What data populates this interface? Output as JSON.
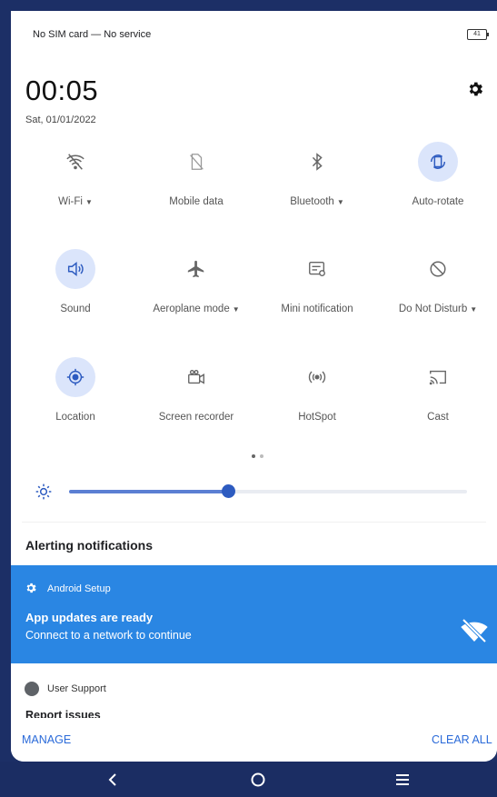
{
  "status": {
    "carrier_text": "No SIM card — No service",
    "battery_level": "41"
  },
  "clock": {
    "time": "00:05",
    "date": "Sat, 01/01/2022"
  },
  "tiles": [
    {
      "label": "Wi-Fi",
      "icon": "wifi-off-icon",
      "dropdown": true,
      "active": false
    },
    {
      "label": "Mobile data",
      "icon": "sim-off-icon",
      "dropdown": false,
      "active": false
    },
    {
      "label": "Bluetooth",
      "icon": "bluetooth-icon",
      "dropdown": true,
      "active": false
    },
    {
      "label": "Auto-rotate",
      "icon": "auto-rotate-icon",
      "dropdown": false,
      "active": true
    },
    {
      "label": "Sound",
      "icon": "sound-icon",
      "dropdown": false,
      "active": true
    },
    {
      "label": "Aeroplane mode",
      "icon": "airplane-icon",
      "dropdown": true,
      "active": false
    },
    {
      "label": "Mini notification",
      "icon": "mini-notification-icon",
      "dropdown": false,
      "active": false
    },
    {
      "label": "Do Not Disturb",
      "icon": "do-not-disturb-icon",
      "dropdown": true,
      "active": false
    },
    {
      "label": "Location",
      "icon": "location-icon",
      "dropdown": false,
      "active": true
    },
    {
      "label": "Screen recorder",
      "icon": "screen-recorder-icon",
      "dropdown": false,
      "active": false
    },
    {
      "label": "HotSpot",
      "icon": "hotspot-icon",
      "dropdown": false,
      "active": false
    },
    {
      "label": "Cast",
      "icon": "cast-icon",
      "dropdown": false,
      "active": false
    }
  ],
  "pager": {
    "pages": 2,
    "current": 1
  },
  "brightness": {
    "level": 0.4
  },
  "notifications": {
    "section_title": "Alerting notifications",
    "android_setup": {
      "app_name": "Android Setup",
      "title": "App updates are ready",
      "text": "Connect to a network to continue"
    },
    "user_support": {
      "app_name": "User Support",
      "title": "Report issues"
    }
  },
  "footer": {
    "manage_label": "MANAGE",
    "clear_all_label": "CLEAR ALL"
  },
  "colors": {
    "accent": "#2a86e3",
    "active_tile": "#dbe5fb",
    "nav_bar": "#1b2d63"
  }
}
